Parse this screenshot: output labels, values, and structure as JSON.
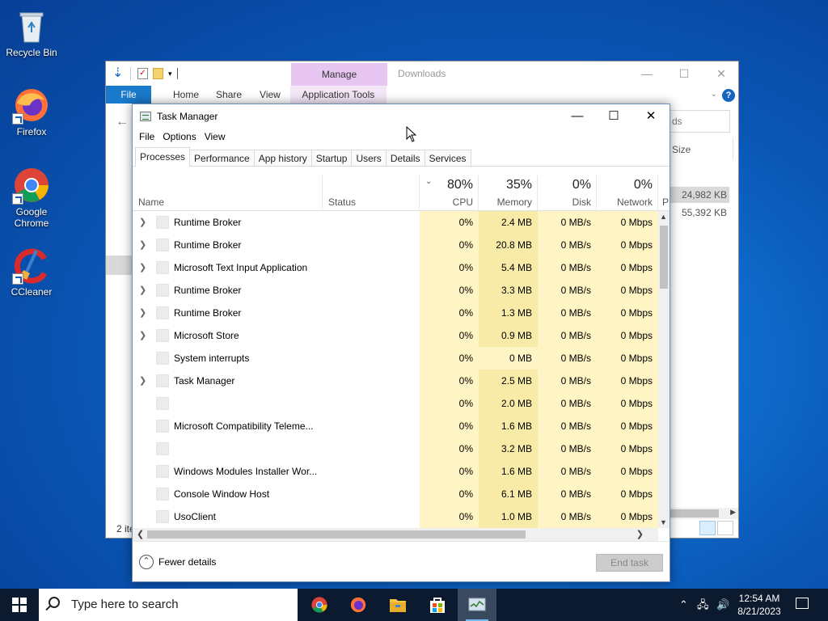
{
  "desktop": {
    "icons": [
      {
        "label": "Recycle Bin"
      },
      {
        "label": "Firefox"
      },
      {
        "label": "Google Chrome"
      },
      {
        "label": "CCleaner"
      }
    ]
  },
  "explorer": {
    "contextual_tab": "Manage",
    "title": "Downloads",
    "ribbon_tabs": [
      "File",
      "Home",
      "Share",
      "View",
      "Application Tools"
    ],
    "search_partial": "ds",
    "column_size": "Size",
    "rows": [
      "24,982 KB",
      "55,392 KB"
    ],
    "status_partial": "2 ite"
  },
  "taskmanager": {
    "title": "Task Manager",
    "menu": [
      "File",
      "Options",
      "View"
    ],
    "tabs": [
      "Processes",
      "Performance",
      "App history",
      "Startup",
      "Users",
      "Details",
      "Services"
    ],
    "active_tab": "Processes",
    "columns": {
      "name": "Name",
      "status": "Status",
      "cpu": {
        "pct": "80%",
        "label": "CPU"
      },
      "memory": {
        "pct": "35%",
        "label": "Memory"
      },
      "disk": {
        "pct": "0%",
        "label": "Disk"
      },
      "network": {
        "pct": "0%",
        "label": "Network"
      },
      "next_partial": "P"
    },
    "processes": [
      {
        "name": "Runtime Broker",
        "expandable": true,
        "cpu": "0%",
        "memory": "2.4 MB",
        "disk": "0 MB/s",
        "network": "0 Mbps"
      },
      {
        "name": "Runtime Broker",
        "expandable": true,
        "cpu": "0%",
        "memory": "20.8 MB",
        "disk": "0 MB/s",
        "network": "0 Mbps"
      },
      {
        "name": "Microsoft Text Input Application",
        "expandable": true,
        "cpu": "0%",
        "memory": "5.4 MB",
        "disk": "0 MB/s",
        "network": "0 Mbps"
      },
      {
        "name": "Runtime Broker",
        "expandable": true,
        "cpu": "0%",
        "memory": "3.3 MB",
        "disk": "0 MB/s",
        "network": "0 Mbps"
      },
      {
        "name": "Runtime Broker",
        "expandable": true,
        "cpu": "0%",
        "memory": "1.3 MB",
        "disk": "0 MB/s",
        "network": "0 Mbps"
      },
      {
        "name": "Microsoft Store",
        "expandable": true,
        "cpu": "0%",
        "memory": "0.9 MB",
        "disk": "0 MB/s",
        "network": "0 Mbps"
      },
      {
        "name": "System interrupts",
        "expandable": false,
        "cpu": "0%",
        "memory": "0 MB",
        "disk": "0 MB/s",
        "network": "0 Mbps"
      },
      {
        "name": "Task Manager",
        "expandable": true,
        "cpu": "0%",
        "memory": "2.5 MB",
        "disk": "0 MB/s",
        "network": "0 Mbps"
      },
      {
        "name": "",
        "expandable": false,
        "cpu": "0%",
        "memory": "2.0 MB",
        "disk": "0 MB/s",
        "network": "0 Mbps"
      },
      {
        "name": "Microsoft Compatibility Teleme...",
        "expandable": false,
        "cpu": "0%",
        "memory": "1.6 MB",
        "disk": "0 MB/s",
        "network": "0 Mbps"
      },
      {
        "name": "",
        "expandable": false,
        "cpu": "0%",
        "memory": "3.2 MB",
        "disk": "0 MB/s",
        "network": "0 Mbps"
      },
      {
        "name": "Windows Modules Installer Wor...",
        "expandable": false,
        "cpu": "0%",
        "memory": "1.6 MB",
        "disk": "0 MB/s",
        "network": "0 Mbps"
      },
      {
        "name": "Console Window Host",
        "expandable": false,
        "cpu": "0%",
        "memory": "6.1 MB",
        "disk": "0 MB/s",
        "network": "0 Mbps"
      },
      {
        "name": "UsoClient",
        "expandable": false,
        "cpu": "0%",
        "memory": "1.0 MB",
        "disk": "0 MB/s",
        "network": "0 Mbps"
      }
    ],
    "fewer_details": "Fewer details",
    "end_task": "End task"
  },
  "taskbar": {
    "search_placeholder": "Type here to search",
    "apps": [
      "chrome-icon",
      "firefox-icon",
      "file-explorer-icon",
      "microsoft-store-icon",
      "task-manager-icon"
    ],
    "time": "12:54 AM",
    "date": "8/21/2023"
  }
}
